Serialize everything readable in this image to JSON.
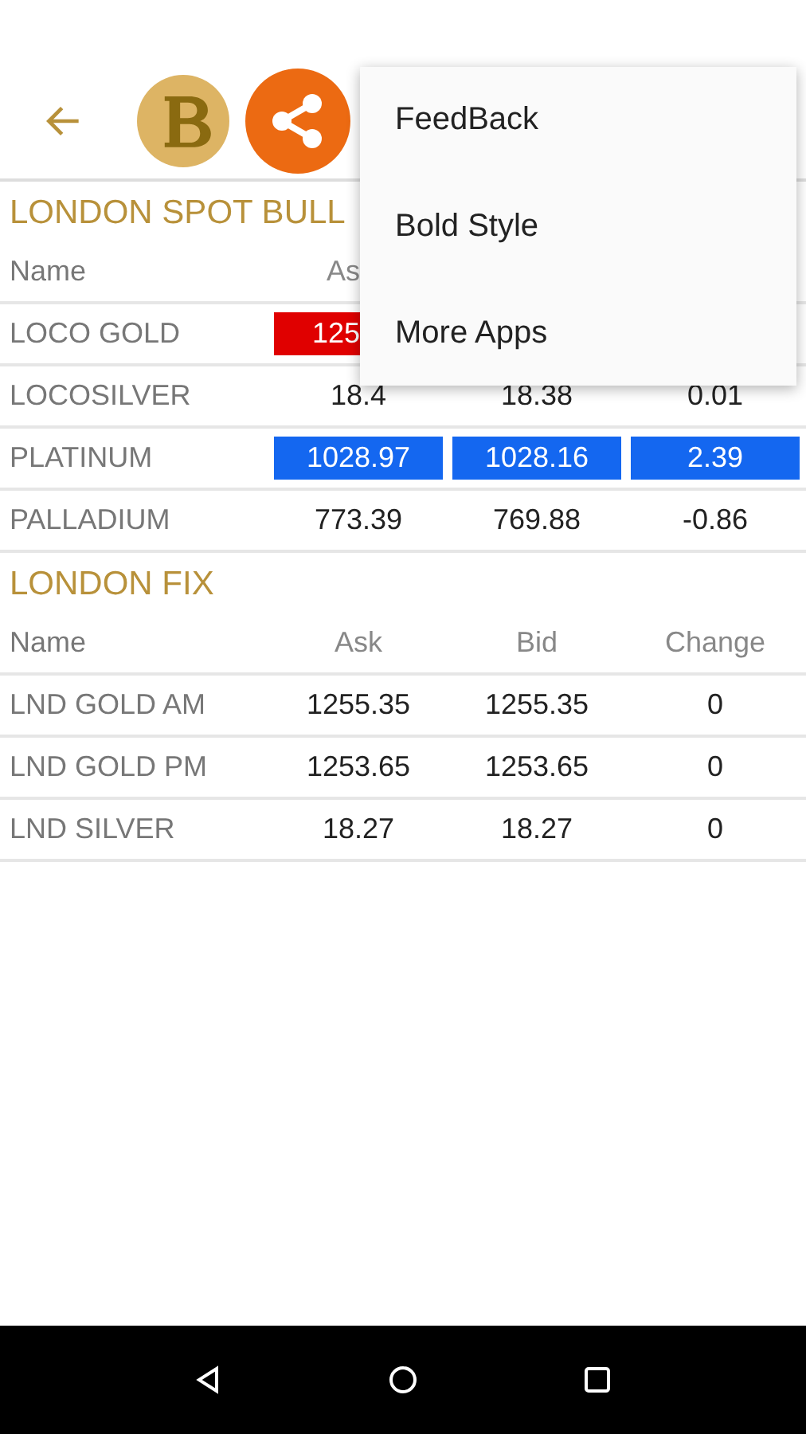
{
  "sections": [
    {
      "title": "LONDON SPOT BULL",
      "header": [
        "Name",
        "As"
      ],
      "rows": [
        {
          "cells": [
            {
              "text": "LOCO GOLD"
            },
            {
              "text": "125",
              "color": "#e00000"
            }
          ]
        },
        {
          "cells": [
            {
              "text": "LOCOSILVER"
            },
            {
              "text": "18.4"
            },
            {
              "text": "18.38"
            },
            {
              "text": "0.01"
            }
          ]
        },
        {
          "cells": [
            {
              "text": "PLATINUM"
            },
            {
              "text": "1028.97",
              "color": "#1467f0"
            },
            {
              "text": "1028.16",
              "color": "#1467f0"
            },
            {
              "text": "2.39",
              "color": "#1467f0"
            }
          ]
        },
        {
          "cells": [
            {
              "text": "PALLADIUM"
            },
            {
              "text": "773.39"
            },
            {
              "text": "769.88"
            },
            {
              "text": "-0.86"
            }
          ]
        }
      ]
    },
    {
      "title": "LONDON FIX",
      "header": [
        "Name",
        "Ask",
        "Bid",
        "Change"
      ],
      "rows": [
        {
          "cells": [
            {
              "text": "LND GOLD AM"
            },
            {
              "text": "1255.35"
            },
            {
              "text": "1255.35"
            },
            {
              "text": "0"
            }
          ]
        },
        {
          "cells": [
            {
              "text": "LND GOLD PM"
            },
            {
              "text": "1253.65"
            },
            {
              "text": "1253.65"
            },
            {
              "text": "0"
            }
          ]
        },
        {
          "cells": [
            {
              "text": "LND SILVER"
            },
            {
              "text": "18.27"
            },
            {
              "text": "18.27"
            },
            {
              "text": "0"
            }
          ]
        }
      ]
    }
  ],
  "menu": {
    "items": [
      "FeedBack",
      "Bold Style",
      "More Apps"
    ]
  }
}
